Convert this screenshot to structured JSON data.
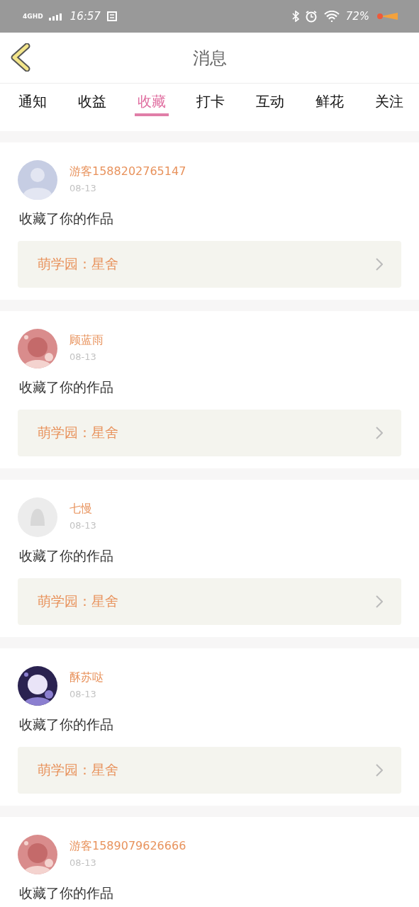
{
  "status_bar": {
    "network": "4GHD",
    "time": "16:57",
    "battery": "72%"
  },
  "header": {
    "title": "消息"
  },
  "tabs": [
    {
      "label": "通知",
      "selected": false
    },
    {
      "label": "收益",
      "selected": false
    },
    {
      "label": "收藏",
      "selected": true
    },
    {
      "label": "打卡",
      "selected": false
    },
    {
      "label": "互动",
      "selected": false
    },
    {
      "label": "鲜花",
      "selected": false
    },
    {
      "label": "关注",
      "selected": false
    }
  ],
  "messages": [
    {
      "avatar": {
        "kind": "silhouette"
      },
      "name": "游客1588202765147",
      "date": "08-13",
      "text": "收藏了你的作品",
      "work": "萌学园：星舍"
    },
    {
      "name": "顾蓝雨",
      "date": "08-13",
      "text": "收藏了你的作品",
      "work": "萌学园：星舍"
    },
    {
      "avatar": {
        "kind": "ghost"
      },
      "name": "七慢",
      "date": "08-13",
      "text": "收藏了你的作品",
      "work": "萌学园：星舍"
    },
    {
      "name": "酥苏哒",
      "date": "08-13",
      "text": "收藏了你的作品",
      "work": "萌学园：星舍"
    },
    {
      "name": "游客1589079626666",
      "date": "08-13",
      "text": "收藏了你的作品"
    }
  ]
}
